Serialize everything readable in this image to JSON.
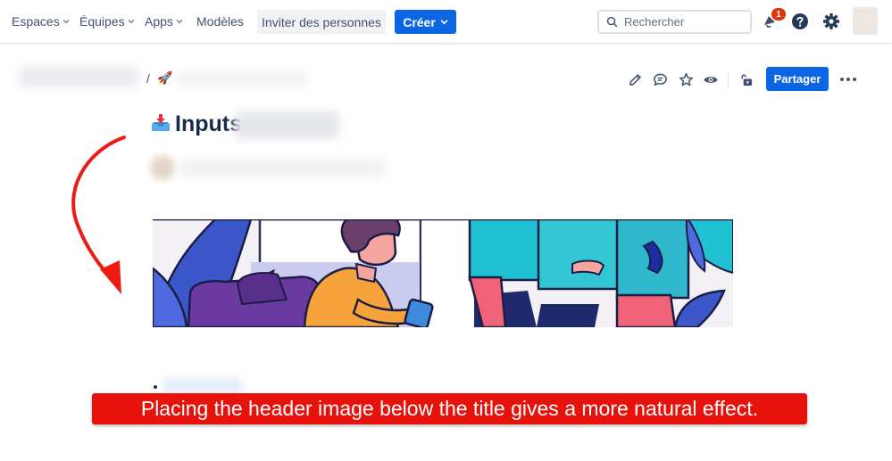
{
  "nav": {
    "items": [
      {
        "label": "Espaces",
        "dropdown": true
      },
      {
        "label": "Équipes",
        "dropdown": true
      },
      {
        "label": "Apps",
        "dropdown": true
      },
      {
        "label": "Modèles",
        "dropdown": false
      }
    ],
    "invite_label": "Inviter des personnes",
    "create_label": "Créer",
    "search_placeholder": "Rechercher",
    "notification_count": "1",
    "icons": [
      "search-icon",
      "notification-icon",
      "help-icon",
      "settings-icon",
      "avatar"
    ]
  },
  "page": {
    "breadcrumb_separator": "/",
    "breadcrumb_emoji": "🚀",
    "title": "Inputs",
    "toolbar_icons": [
      "edit-icon",
      "comment-icon",
      "star-icon",
      "watch-icon",
      "restrictions-icon"
    ],
    "share_label": "Partager"
  },
  "annotation": {
    "text": "Placing the header image below the title gives a more natural effect."
  },
  "colors": {
    "brand_blue": "#0c66e4",
    "annotation_red": "#e8120c",
    "text_primary": "#172b4d",
    "text_secondary": "#42526e"
  }
}
